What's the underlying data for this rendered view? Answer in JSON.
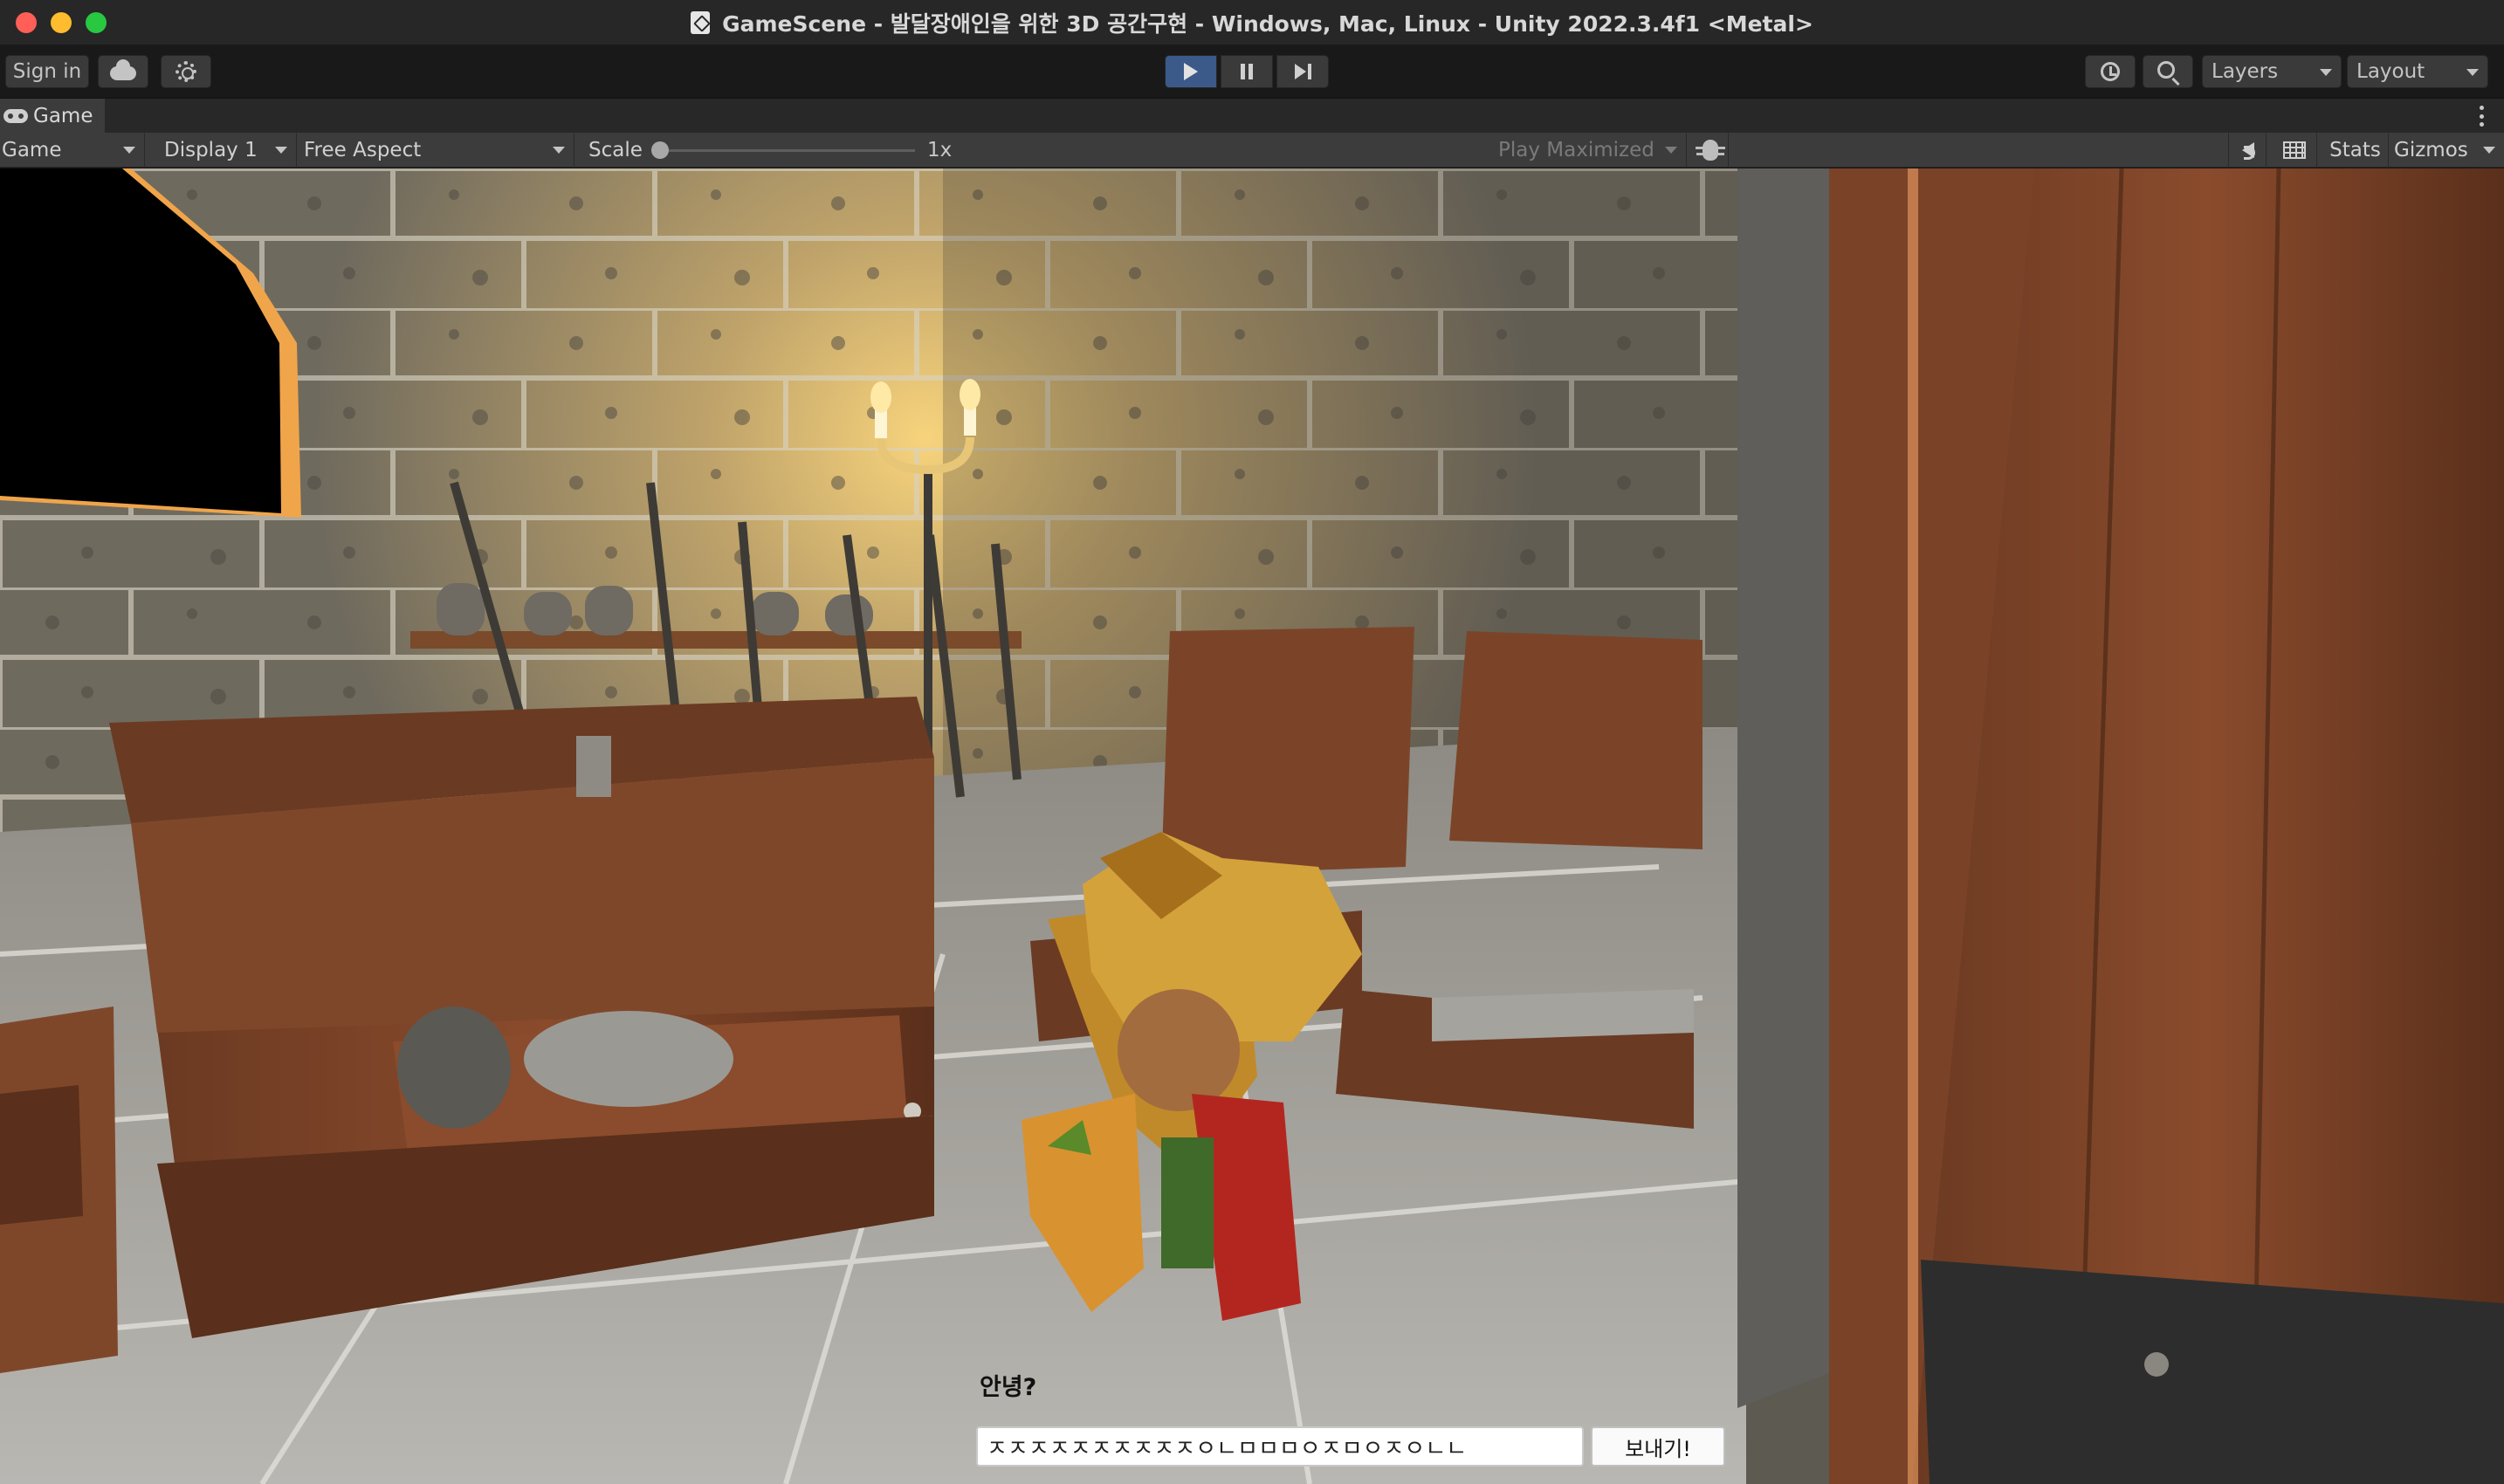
{
  "window": {
    "title": "GameScene - 발달장애인을 위한 3D 공간구현 - Windows, Mac, Linux - Unity 2022.3.4f1 <Metal>"
  },
  "toolbar": {
    "sign_in_label": "Sign in",
    "layers_label": "Layers",
    "layout_label": "Layout"
  },
  "panel": {
    "tab_label": "Game"
  },
  "game_bar": {
    "view_select": "Game",
    "display_select": "Display 1",
    "aspect_select": "Free Aspect",
    "scale_label": "Scale",
    "scale_value": "1x",
    "play_mode_select": "Play Maximized",
    "stats_label": "Stats",
    "gizmos_label": "Gizmos"
  },
  "game_ui": {
    "greeting_text": "안녕?",
    "chat_input_value": "ㅈㅈㅈㅈㅈㅈㅈㅈㅈㅈㅇㄴㅁㅁㅁㅇㅈㅁㅇㅈㅇㄴㄴ",
    "send_button_label": "보내기!"
  },
  "colors": {
    "play_active": "#3b5a8a",
    "editor_bg": "#191919",
    "panel_bg": "#3c3c3c"
  },
  "icons": {
    "play": "play-icon",
    "pause": "pause-icon",
    "step": "step-icon",
    "cloud": "cloud-icon",
    "collab": "gear-icon",
    "history": "history-icon",
    "search": "search-icon",
    "audio": "speaker-icon",
    "grid": "grid-icon",
    "bug": "bug-icon",
    "tab": "gamepad-icon"
  }
}
